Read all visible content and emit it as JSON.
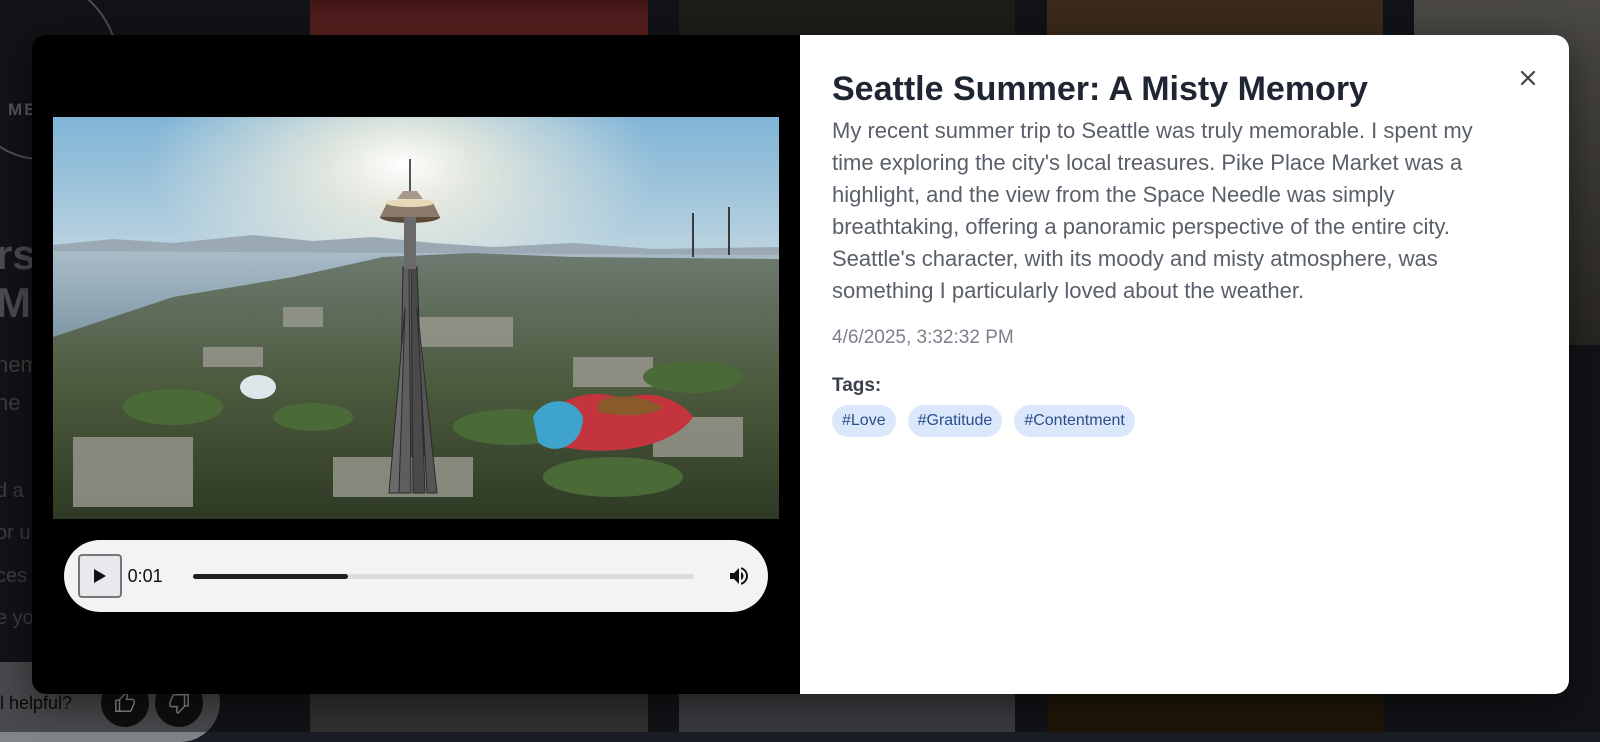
{
  "background": {
    "logo_text": "ME",
    "headings": [
      "rs",
      "M"
    ],
    "lines": [
      "hem",
      "he"
    ],
    "lines2": [
      "d a",
      "or u",
      "ces",
      "e yo"
    ],
    "helpful_label": "l helpful?",
    "thumb_up_icon": "thumbs-up-icon",
    "thumb_down_icon": "thumbs-down-icon"
  },
  "modal": {
    "title": "Seattle Summer: A Misty Memory",
    "description": "My recent summer trip to Seattle was truly memorable. I spent my time exploring the city's local treasures. Pike Place Market was a highlight, and the view from the Space Needle was simply breathtaking, offering a panoramic perspective of the entire city. Seattle's character, with its moody and misty atmosphere, was something I particularly loved about the weather.",
    "date": "4/6/2025, 3:32:32 PM",
    "tags_label": "Tags:",
    "tags": [
      "#Love",
      "#Gratitude",
      "#Contentment"
    ],
    "close_icon": "close-icon"
  },
  "player": {
    "time": "0:01",
    "progress": 0.31,
    "play_icon": "play-icon",
    "volume_icon": "volume-icon"
  }
}
